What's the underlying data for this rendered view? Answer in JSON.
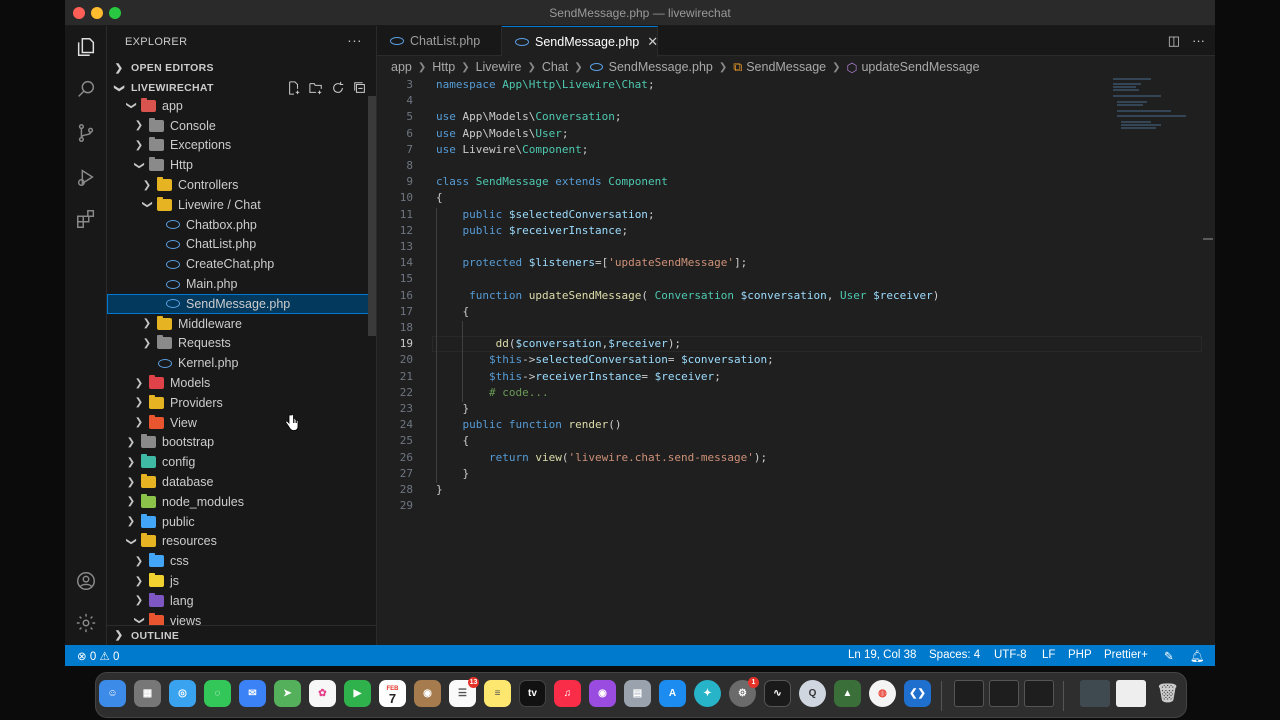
{
  "window": {
    "title": "SendMessage.php — livewirechat"
  },
  "explorer": {
    "header": "EXPLORER",
    "open_editors": "OPEN EDITORS",
    "project": "LIVEWIRECHAT",
    "outline": "OUTLINE",
    "tree": [
      {
        "label": "app",
        "depth": 0,
        "kind": "folder",
        "open": true,
        "color": "#d9534f"
      },
      {
        "label": "Console",
        "depth": 1,
        "kind": "folder",
        "open": false,
        "color": "#8a8a8a"
      },
      {
        "label": "Exceptions",
        "depth": 1,
        "kind": "folder",
        "open": false,
        "color": "#8a8a8a"
      },
      {
        "label": "Http",
        "depth": 1,
        "kind": "folder",
        "open": true,
        "color": "#8a8a8a"
      },
      {
        "label": "Controllers",
        "depth": 2,
        "kind": "folder",
        "open": false,
        "color": "#e6b422"
      },
      {
        "label": "Livewire / Chat",
        "depth": 2,
        "kind": "folder",
        "open": true,
        "color": "#e6b422"
      },
      {
        "label": "Chatbox.php",
        "depth": 3,
        "kind": "php"
      },
      {
        "label": "ChatList.php",
        "depth": 3,
        "kind": "php"
      },
      {
        "label": "CreateChat.php",
        "depth": 3,
        "kind": "php"
      },
      {
        "label": "Main.php",
        "depth": 3,
        "kind": "php"
      },
      {
        "label": "SendMessage.php",
        "depth": 3,
        "kind": "php",
        "selected": true
      },
      {
        "label": "Middleware",
        "depth": 2,
        "kind": "folder",
        "open": false,
        "color": "#e6b422"
      },
      {
        "label": "Requests",
        "depth": 2,
        "kind": "folder",
        "open": false,
        "color": "#8a8a8a"
      },
      {
        "label": "Kernel.php",
        "depth": 2,
        "kind": "php"
      },
      {
        "label": "Models",
        "depth": 1,
        "kind": "folder",
        "open": false,
        "color": "#e0424a"
      },
      {
        "label": "Providers",
        "depth": 1,
        "kind": "folder",
        "open": false,
        "color": "#e6b422"
      },
      {
        "label": "View",
        "depth": 1,
        "kind": "folder",
        "open": false,
        "color": "#e8552e"
      },
      {
        "label": "bootstrap",
        "depth": 0,
        "kind": "folder",
        "open": false,
        "color": "#8a8a8a"
      },
      {
        "label": "config",
        "depth": 0,
        "kind": "folder",
        "open": false,
        "color": "#3fb8a4"
      },
      {
        "label": "database",
        "depth": 0,
        "kind": "folder",
        "open": false,
        "color": "#e6b422"
      },
      {
        "label": "node_modules",
        "depth": 0,
        "kind": "folder",
        "open": false,
        "color": "#8bc34a"
      },
      {
        "label": "public",
        "depth": 0,
        "kind": "folder",
        "open": false,
        "color": "#42a5f5"
      },
      {
        "label": "resources",
        "depth": 0,
        "kind": "folder",
        "open": true,
        "color": "#e6b422"
      },
      {
        "label": "css",
        "depth": 1,
        "kind": "folder",
        "open": false,
        "color": "#42a5f5"
      },
      {
        "label": "js",
        "depth": 1,
        "kind": "folder",
        "open": false,
        "color": "#f0d130"
      },
      {
        "label": "lang",
        "depth": 1,
        "kind": "folder",
        "open": false,
        "color": "#7e57c2"
      },
      {
        "label": "views",
        "depth": 1,
        "kind": "folder",
        "open": true,
        "color": "#e8552e"
      }
    ]
  },
  "tabs": [
    {
      "label": "ChatList.php",
      "active": false
    },
    {
      "label": "SendMessage.php",
      "active": true
    }
  ],
  "breadcrumbs": [
    "app",
    "Http",
    "Livewire",
    "Chat",
    "SendMessage.php",
    "SendMessage",
    "updateSendMessage"
  ],
  "code": {
    "active_line": 19,
    "lines": [
      {
        "n": 3,
        "segs": [
          [
            "kw",
            "namespace "
          ],
          [
            "ty",
            "App\\Http\\Livewire\\Chat"
          ],
          [
            "",
            ";"
          ]
        ]
      },
      {
        "n": 4,
        "segs": []
      },
      {
        "n": 5,
        "segs": [
          [
            "kw",
            "use "
          ],
          [
            "",
            "App\\Models\\"
          ],
          [
            "ty",
            "Conversation"
          ],
          [
            "",
            ";"
          ]
        ]
      },
      {
        "n": 6,
        "segs": [
          [
            "kw",
            "use "
          ],
          [
            "",
            "App\\Models\\"
          ],
          [
            "ty",
            "User"
          ],
          [
            "",
            ";"
          ]
        ]
      },
      {
        "n": 7,
        "segs": [
          [
            "kw",
            "use "
          ],
          [
            "",
            "Livewire\\"
          ],
          [
            "ty",
            "Component"
          ],
          [
            "",
            ";"
          ]
        ]
      },
      {
        "n": 8,
        "segs": []
      },
      {
        "n": 9,
        "segs": [
          [
            "kw",
            "class "
          ],
          [
            "ty",
            "SendMessage "
          ],
          [
            "kw",
            "extends "
          ],
          [
            "ty",
            "Component"
          ]
        ]
      },
      {
        "n": 10,
        "segs": [
          [
            "",
            "{"
          ]
        ]
      },
      {
        "n": 11,
        "segs": [
          [
            "",
            "    "
          ],
          [
            "kw",
            "public "
          ],
          [
            "vr",
            "$selectedConversation"
          ],
          [
            "",
            ";"
          ]
        ]
      },
      {
        "n": 12,
        "segs": [
          [
            "",
            "    "
          ],
          [
            "kw",
            "public "
          ],
          [
            "vr",
            "$receiverInstance"
          ],
          [
            "",
            ";"
          ]
        ]
      },
      {
        "n": 13,
        "segs": []
      },
      {
        "n": 14,
        "segs": [
          [
            "",
            "    "
          ],
          [
            "kw",
            "protected "
          ],
          [
            "vr",
            "$listeners"
          ],
          [
            "",
            "=["
          ],
          [
            "st",
            "'updateSendMessage'"
          ],
          [
            "",
            "];"
          ]
        ]
      },
      {
        "n": 15,
        "segs": []
      },
      {
        "n": 16,
        "segs": [
          [
            "",
            "     "
          ],
          [
            "kw",
            "function "
          ],
          [
            "fn",
            "updateSendMessage"
          ],
          [
            "",
            "( "
          ],
          [
            "ty",
            "Conversation "
          ],
          [
            "vr",
            "$conversation"
          ],
          [
            "",
            ", "
          ],
          [
            "ty",
            "User "
          ],
          [
            "vr",
            "$receiver"
          ],
          [
            "",
            ")"
          ]
        ]
      },
      {
        "n": 17,
        "segs": [
          [
            "",
            "    {"
          ]
        ]
      },
      {
        "n": 18,
        "segs": []
      },
      {
        "n": 19,
        "segs": [
          [
            "",
            "         "
          ],
          [
            "fn",
            "dd"
          ],
          [
            "",
            "("
          ],
          [
            "vr",
            "$conversation"
          ],
          [
            "",
            ","
          ],
          [
            "vr",
            "$receiver"
          ],
          [
            "",
            ");"
          ]
        ]
      },
      {
        "n": 20,
        "segs": [
          [
            "",
            "        "
          ],
          [
            "kw",
            "$this"
          ],
          [
            "",
            "->"
          ],
          [
            "vr",
            "selectedConversation"
          ],
          [
            "",
            "= "
          ],
          [
            "vr",
            "$conversation"
          ],
          [
            "",
            ";"
          ]
        ]
      },
      {
        "n": 21,
        "segs": [
          [
            "",
            "        "
          ],
          [
            "kw",
            "$this"
          ],
          [
            "",
            "->"
          ],
          [
            "vr",
            "receiverInstance"
          ],
          [
            "",
            "= "
          ],
          [
            "vr",
            "$receiver"
          ],
          [
            "",
            ";"
          ]
        ]
      },
      {
        "n": 22,
        "segs": [
          [
            "",
            "        "
          ],
          [
            "cm",
            "# code..."
          ]
        ]
      },
      {
        "n": 23,
        "segs": [
          [
            "",
            "    }"
          ]
        ]
      },
      {
        "n": 24,
        "segs": [
          [
            "",
            "    "
          ],
          [
            "kw",
            "public "
          ],
          [
            "kw",
            "function "
          ],
          [
            "fn",
            "render"
          ],
          [
            "",
            "()"
          ]
        ]
      },
      {
        "n": 25,
        "segs": [
          [
            "",
            "    {"
          ]
        ]
      },
      {
        "n": 26,
        "segs": [
          [
            "",
            "        "
          ],
          [
            "kw",
            "return "
          ],
          [
            "fn",
            "view"
          ],
          [
            "",
            "("
          ],
          [
            "st",
            "'livewire.chat.send-message'"
          ],
          [
            "",
            ");"
          ]
        ]
      },
      {
        "n": 27,
        "segs": [
          [
            "",
            "    }"
          ]
        ]
      },
      {
        "n": 28,
        "segs": [
          [
            "",
            "}"
          ]
        ]
      },
      {
        "n": 29,
        "segs": []
      }
    ]
  },
  "status": {
    "problems": "0",
    "warnings": "0",
    "position": "Ln 19, Col 38",
    "spaces": "Spaces: 4",
    "encoding": "UTF-8",
    "eol": "LF",
    "language": "PHP",
    "formatter": "Prettier+"
  },
  "dock": {
    "calendar_month": "FEB",
    "calendar_day": "7",
    "appletv": "tv",
    "reminders_badge": "13",
    "settings_badge": "1"
  },
  "colors": {
    "accent": "#007acc",
    "selection": "#04395e"
  }
}
